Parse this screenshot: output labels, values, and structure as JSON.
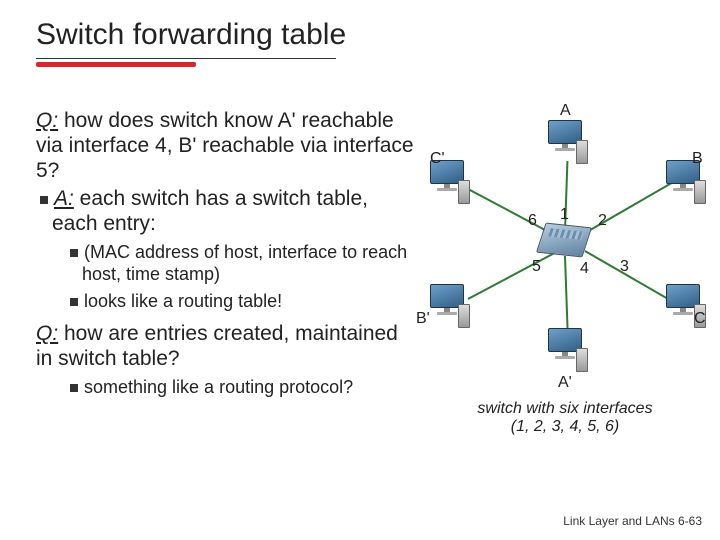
{
  "title": "Switch forwarding table",
  "text": {
    "q1_label": "Q:",
    "q1_body": " how does switch know A' reachable via interface 4, B' reachable via interface 5?",
    "a_label": "A:",
    "a_body": "  each switch has a switch table, each entry:",
    "sub1": "(MAC address of host, interface to reach host, time stamp)",
    "sub2": "looks like a routing table!",
    "q2_label": "Q:",
    "q2_body": " how are entries created, maintained in switch table?",
    "sub3": "something like a routing protocol?"
  },
  "diagram": {
    "hosts": {
      "A": "A",
      "B": "B",
      "C": "C",
      "Ap": "A'",
      "Bp": "B'",
      "Cp": "C'"
    },
    "ports": {
      "p1": "1",
      "p2": "2",
      "p3": "3",
      "p4": "4",
      "p5": "5",
      "p6": "6"
    },
    "caption1": "switch with six interfaces",
    "caption2": "(1, 2, 3, 4, 5, 6)"
  },
  "footer": "Link Layer and LANs   6-63"
}
